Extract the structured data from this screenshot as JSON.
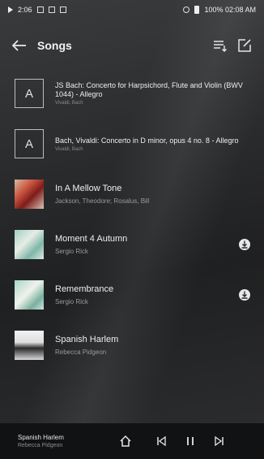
{
  "status_bar": {
    "left_text": "2:06",
    "right_text": "100% 02:08 AM"
  },
  "toolbar": {
    "title": "Songs"
  },
  "songs": [
    {
      "thumb_letter": "A",
      "title": "JS Bach: Concerto for Harpsichord, Flute and Violin (BWV 1044) - Allegro",
      "artist": "Vivaldi, Bach"
    },
    {
      "thumb_letter": "A",
      "title": "Bach, Vivaldi: Concerto in D minor, opus 4 no. 8 - Allegro",
      "artist": "Vivaldi, Bach"
    },
    {
      "title": "In A Mellow Tone",
      "artist": "Jackson, Theodore; Rosalus, Bill",
      "art_colors": [
        "#c8533e",
        "#7d1c1b"
      ]
    },
    {
      "title": "Moment 4 Autumn",
      "artist": "Sergio Rick",
      "art_colors": [
        "#9ed0c4",
        "#e6ece6"
      ]
    },
    {
      "title": "Remembrance",
      "artist": "Sergio Rick",
      "art_colors": [
        "#a7d6c7",
        "#f0f2ec"
      ]
    },
    {
      "title": "Spanish Harlem",
      "artist": "Rebecca Pidgeon",
      "art_colors": [
        "#2a2a2a",
        "#f2f2f2"
      ]
    }
  ],
  "mini_player": {
    "title": "Spanish Harlem",
    "artist": "Rebecca Pidgeon"
  }
}
